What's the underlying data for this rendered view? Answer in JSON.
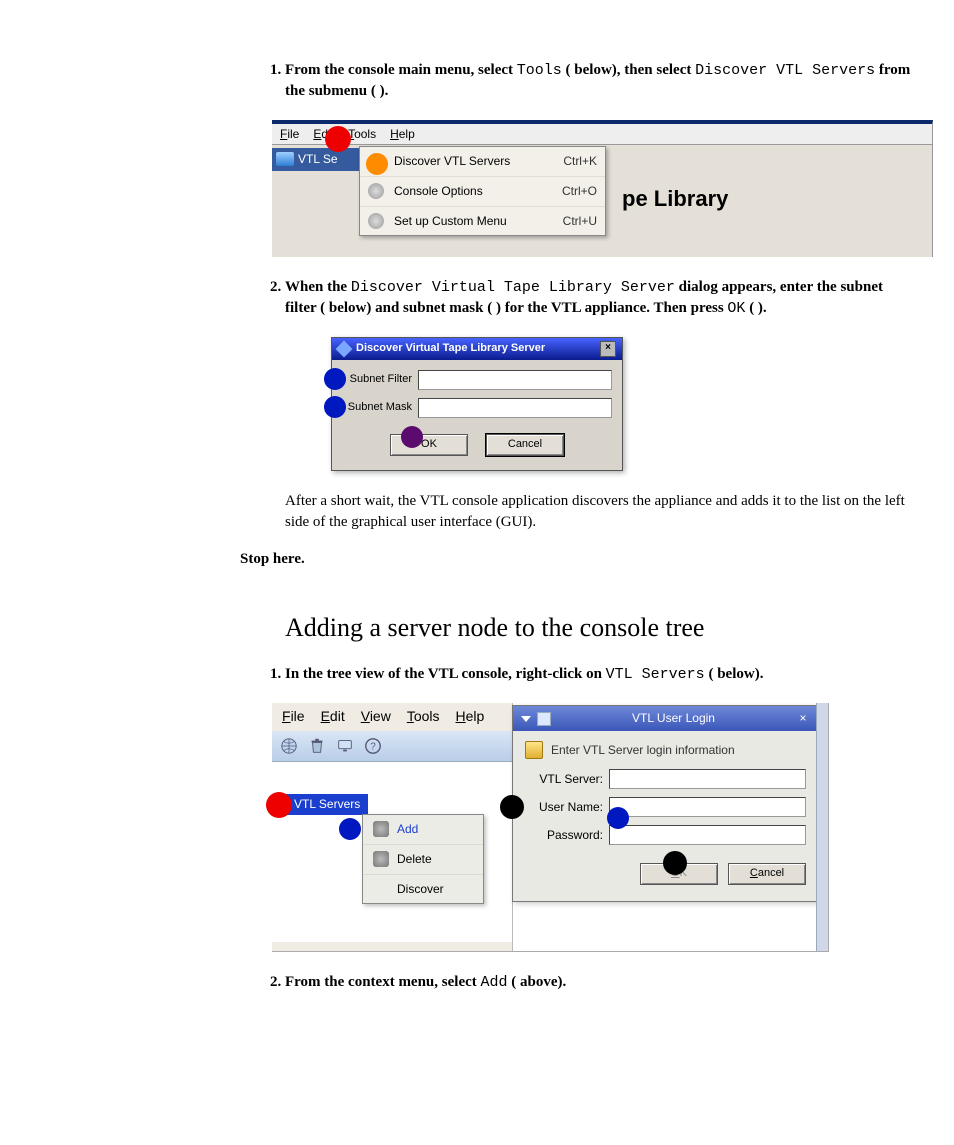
{
  "step1": {
    "lead": "From the console main menu, select ",
    "tools": "Tools",
    "mid": " (   below), then select ",
    "discover": "Discover VTL Servers",
    "tail": " from the submenu (  )."
  },
  "fig1": {
    "menubar": {
      "file": "File",
      "edit": "Edit",
      "tools": "Tools",
      "help": "Help"
    },
    "sidebar_label": "VTL Se",
    "menu": {
      "row1": {
        "label": "Discover VTL Servers",
        "shortcut": "Ctrl+K"
      },
      "row2": {
        "label": "Console Options",
        "shortcut": "Ctrl+O"
      },
      "row3": {
        "label": "Set up Custom Menu",
        "shortcut": "Ctrl+U"
      }
    },
    "right_text": "pe Library"
  },
  "step2": {
    "lead": "When the ",
    "dlgname": "Discover Virtual Tape Library Server",
    "mid1": " dialog appears, enter the subnet filter (   below) and subnet mask (  ) for the VTL appliance. Then press ",
    "ok": "OK",
    "tail": " (  )."
  },
  "fig2": {
    "title": "Discover Virtual Tape Library Server",
    "field1": "Subnet Filter",
    "field2": "Subnet Mask",
    "ok": "OK",
    "cancel": "Cancel"
  },
  "after_para": "After a short wait, the VTL console application discovers the appliance and adds it to the list on the left side of the graphical user interface (GUI).",
  "stop_here": "Stop here.",
  "section_title": "Adding a server node to the console tree",
  "step3": {
    "lead": "In the tree view of the VTL console, right-click on ",
    "target": "VTL Servers",
    "tail": " (   below)."
  },
  "fig3": {
    "menubar": {
      "file": "File",
      "edit": "Edit",
      "view": "View",
      "tools": "Tools",
      "help": "Help"
    },
    "tree_label": "VTL Servers",
    "ctx": {
      "add": "Add",
      "delete": "Delete",
      "discover": "Discover"
    },
    "login": {
      "title": "VTL User Login",
      "prompt": "Enter VTL Server login information",
      "f1": "VTL Server:",
      "f2": "User Name:",
      "f3": "Password:",
      "ok": "OK",
      "cancel": "Cancel"
    }
  },
  "step4": {
    "lead": "From the context menu, select ",
    "add": "Add",
    "tail": " (   above)."
  }
}
